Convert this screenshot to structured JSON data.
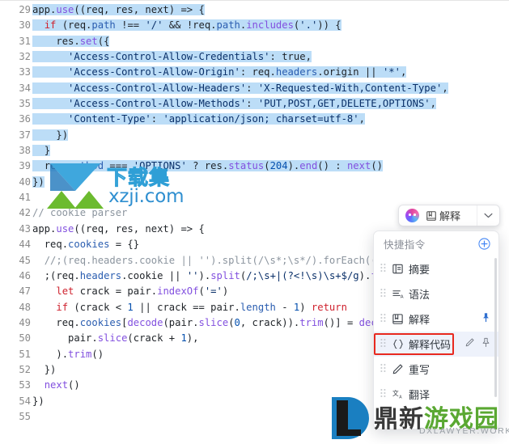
{
  "editor": {
    "language": "javascript",
    "first_line_number": 29,
    "selection_color": "#bcddf7",
    "lines": [
      {
        "n": 29,
        "sel": true,
        "indent": 0,
        "tokens": [
          {
            "t": "app",
            "c": "plain"
          },
          {
            "t": ".",
            "c": "op"
          },
          {
            "t": "use",
            "c": "fn"
          },
          {
            "t": "((req, res, next) => {",
            "c": "plain"
          }
        ]
      },
      {
        "n": 30,
        "sel": true,
        "indent": 1,
        "tokens": [
          {
            "t": "if",
            "c": "kw"
          },
          {
            "t": " (req.",
            "c": "plain"
          },
          {
            "t": "path",
            "c": "prop"
          },
          {
            "t": " !== ",
            "c": "plain"
          },
          {
            "t": "'/'",
            "c": "str"
          },
          {
            "t": " && !req.",
            "c": "plain"
          },
          {
            "t": "path",
            "c": "prop"
          },
          {
            "t": ".",
            "c": "op"
          },
          {
            "t": "includes",
            "c": "fn"
          },
          {
            "t": "(",
            "c": "plain"
          },
          {
            "t": "'.'",
            "c": "str"
          },
          {
            "t": ")) {",
            "c": "plain"
          }
        ]
      },
      {
        "n": 31,
        "sel": true,
        "indent": 2,
        "tokens": [
          {
            "t": "res",
            "c": "plain"
          },
          {
            "t": ".",
            "c": "op"
          },
          {
            "t": "set",
            "c": "fn"
          },
          {
            "t": "({",
            "c": "plain"
          }
        ]
      },
      {
        "n": 32,
        "sel": true,
        "indent": 3,
        "tokens": [
          {
            "t": "'Access-Control-Allow-Credentials'",
            "c": "str"
          },
          {
            "t": ": ",
            "c": "plain"
          },
          {
            "t": "true",
            "c": "plain"
          },
          {
            "t": ",",
            "c": "plain"
          }
        ]
      },
      {
        "n": 33,
        "sel": true,
        "indent": 3,
        "tokens": [
          {
            "t": "'Access-Control-Allow-Origin'",
            "c": "str"
          },
          {
            "t": ": req.",
            "c": "plain"
          },
          {
            "t": "headers",
            "c": "prop"
          },
          {
            "t": ".origin || ",
            "c": "plain"
          },
          {
            "t": "'*'",
            "c": "str"
          },
          {
            "t": ",",
            "c": "plain"
          }
        ]
      },
      {
        "n": 34,
        "sel": true,
        "indent": 3,
        "tokens": [
          {
            "t": "'Access-Control-Allow-Headers'",
            "c": "str"
          },
          {
            "t": ": ",
            "c": "plain"
          },
          {
            "t": "'X-Requested-With,Content-Type'",
            "c": "str"
          },
          {
            "t": ",",
            "c": "plain"
          }
        ]
      },
      {
        "n": 35,
        "sel": true,
        "indent": 3,
        "tokens": [
          {
            "t": "'Access-Control-Allow-Methods'",
            "c": "str"
          },
          {
            "t": ": ",
            "c": "plain"
          },
          {
            "t": "'PUT,POST,GET,DELETE,OPTIONS'",
            "c": "str"
          },
          {
            "t": ",",
            "c": "plain"
          }
        ]
      },
      {
        "n": 36,
        "sel": true,
        "indent": 3,
        "tokens": [
          {
            "t": "'Content-Type'",
            "c": "str"
          },
          {
            "t": ": ",
            "c": "plain"
          },
          {
            "t": "'application/json; charset=utf-8'",
            "c": "str"
          },
          {
            "t": ",",
            "c": "plain"
          }
        ]
      },
      {
        "n": 37,
        "sel": true,
        "indent": 2,
        "tokens": [
          {
            "t": "})",
            "c": "plain"
          }
        ]
      },
      {
        "n": 38,
        "sel": true,
        "indent": 1,
        "tokens": [
          {
            "t": "}",
            "c": "plain"
          }
        ]
      },
      {
        "n": 39,
        "sel": true,
        "indent": 1,
        "tokens": [
          {
            "t": "req.",
            "c": "plain"
          },
          {
            "t": "method",
            "c": "prop"
          },
          {
            "t": " === ",
            "c": "plain"
          },
          {
            "t": "'OPTIONS'",
            "c": "str"
          },
          {
            "t": " ? res.",
            "c": "plain"
          },
          {
            "t": "status",
            "c": "fn"
          },
          {
            "t": "(",
            "c": "plain"
          },
          {
            "t": "204",
            "c": "num"
          },
          {
            "t": ").",
            "c": "plain"
          },
          {
            "t": "end",
            "c": "fn"
          },
          {
            "t": "() : ",
            "c": "plain"
          },
          {
            "t": "next",
            "c": "fn"
          },
          {
            "t": "()",
            "c": "plain"
          }
        ]
      },
      {
        "n": 40,
        "sel": true,
        "indent": 0,
        "tokens": [
          {
            "t": "})",
            "c": "plain"
          }
        ]
      },
      {
        "n": 41,
        "sel": false,
        "indent": 0,
        "tokens": []
      },
      {
        "n": 42,
        "sel": false,
        "indent": 0,
        "tokens": [
          {
            "t": "// cookie parser",
            "c": "com"
          }
        ]
      },
      {
        "n": 43,
        "sel": false,
        "indent": 0,
        "tokens": [
          {
            "t": "app",
            "c": "plain"
          },
          {
            "t": ".",
            "c": "op"
          },
          {
            "t": "use",
            "c": "fn"
          },
          {
            "t": "((req, res, next) => {",
            "c": "plain"
          }
        ]
      },
      {
        "n": 44,
        "sel": false,
        "indent": 1,
        "tokens": [
          {
            "t": "req.",
            "c": "plain"
          },
          {
            "t": "cookies",
            "c": "prop"
          },
          {
            "t": " = {}",
            "c": "plain"
          }
        ]
      },
      {
        "n": 45,
        "sel": false,
        "indent": 1,
        "tokens": [
          {
            "t": "//;(req.headers.cookie || '').split(/\\s*;\\s*/).forEach((pair)",
            "c": "com"
          }
        ]
      },
      {
        "n": 46,
        "sel": false,
        "indent": 1,
        "tokens": [
          {
            "t": ";(req.",
            "c": "plain"
          },
          {
            "t": "headers",
            "c": "prop"
          },
          {
            "t": ".cookie || ",
            "c": "plain"
          },
          {
            "t": "''",
            "c": "str"
          },
          {
            "t": ").",
            "c": "plain"
          },
          {
            "t": "split",
            "c": "fn"
          },
          {
            "t": "(",
            "c": "plain"
          },
          {
            "t": "/;\\s+|(?<!\\s)\\s+$/g",
            "c": "re"
          },
          {
            "t": ").",
            "c": "plain"
          },
          {
            "t": "forEach",
            "c": "fn"
          }
        ]
      },
      {
        "n": 47,
        "sel": false,
        "indent": 2,
        "tokens": [
          {
            "t": "let",
            "c": "kw"
          },
          {
            "t": " crack = pair.",
            "c": "plain"
          },
          {
            "t": "indexOf",
            "c": "fn"
          },
          {
            "t": "(",
            "c": "plain"
          },
          {
            "t": "'='",
            "c": "str"
          },
          {
            "t": ")",
            "c": "plain"
          }
        ]
      },
      {
        "n": 48,
        "sel": false,
        "indent": 2,
        "tokens": [
          {
            "t": "if",
            "c": "kw"
          },
          {
            "t": " (crack < ",
            "c": "plain"
          },
          {
            "t": "1",
            "c": "num"
          },
          {
            "t": " || crack == pair.",
            "c": "plain"
          },
          {
            "t": "length",
            "c": "prop"
          },
          {
            "t": " - ",
            "c": "plain"
          },
          {
            "t": "1",
            "c": "num"
          },
          {
            "t": ") ",
            "c": "plain"
          },
          {
            "t": "return",
            "c": "kw"
          }
        ]
      },
      {
        "n": 49,
        "sel": false,
        "indent": 2,
        "tokens": [
          {
            "t": "req.",
            "c": "plain"
          },
          {
            "t": "cookies",
            "c": "prop"
          },
          {
            "t": "[",
            "c": "plain"
          },
          {
            "t": "decode",
            "c": "fn"
          },
          {
            "t": "(pair.",
            "c": "plain"
          },
          {
            "t": "slice",
            "c": "fn"
          },
          {
            "t": "(",
            "c": "plain"
          },
          {
            "t": "0",
            "c": "num"
          },
          {
            "t": ", crack)).",
            "c": "plain"
          },
          {
            "t": "trim",
            "c": "fn"
          },
          {
            "t": "()] = ",
            "c": "plain"
          },
          {
            "t": "decode",
            "c": "fn"
          },
          {
            "t": "(",
            "c": "plain"
          }
        ]
      },
      {
        "n": 50,
        "sel": false,
        "indent": 3,
        "tokens": [
          {
            "t": "pair.",
            "c": "plain"
          },
          {
            "t": "slice",
            "c": "fn"
          },
          {
            "t": "(crack + ",
            "c": "plain"
          },
          {
            "t": "1",
            "c": "num"
          },
          {
            "t": "),",
            "c": "plain"
          }
        ]
      },
      {
        "n": 51,
        "sel": false,
        "indent": 2,
        "tokens": [
          {
            "t": ").",
            "c": "plain"
          },
          {
            "t": "trim",
            "c": "fn"
          },
          {
            "t": "()",
            "c": "plain"
          }
        ]
      },
      {
        "n": 52,
        "sel": false,
        "indent": 1,
        "tokens": [
          {
            "t": "})",
            "c": "plain"
          }
        ]
      },
      {
        "n": 53,
        "sel": false,
        "indent": 1,
        "tokens": [
          {
            "t": "next",
            "c": "fn"
          },
          {
            "t": "()",
            "c": "plain"
          }
        ]
      },
      {
        "n": 54,
        "sel": false,
        "indent": 0,
        "tokens": [
          {
            "t": "})",
            "c": "plain"
          }
        ]
      },
      {
        "n": 55,
        "sel": false,
        "indent": 0,
        "tokens": []
      }
    ]
  },
  "ai_toolbar": {
    "orb_icon": "ai-orb-icon",
    "action_icon": "book-explain-icon",
    "action_label": "解释",
    "caret_icon": "chevron-down-icon"
  },
  "shortcut_panel": {
    "title": "快捷指令",
    "add_icon": "plus-circle-icon",
    "highlight_color": "#e8291f",
    "items": [
      {
        "icon": "summary-icon",
        "label": "摘要",
        "pinned": false,
        "active": false,
        "highlighted": false
      },
      {
        "icon": "grammar-icon",
        "label": "语法",
        "pinned": false,
        "active": false,
        "highlighted": false
      },
      {
        "icon": "book-explain-icon",
        "label": "解释",
        "pinned": true,
        "active": false,
        "highlighted": false
      },
      {
        "icon": "braces-icon",
        "label": "解释代码",
        "pinned": false,
        "active": true,
        "highlighted": true
      },
      {
        "icon": "pencil-icon",
        "label": "重写",
        "pinned": false,
        "active": false,
        "highlighted": false
      },
      {
        "icon": "translate-icon",
        "label": "翻译",
        "pinned": false,
        "active": false,
        "highlighted": false
      }
    ],
    "row_actions": {
      "edit_icon": "pencil-edit-icon",
      "pin_icon": "pin-outline-icon"
    }
  },
  "watermarks": {
    "primary": {
      "cn": "下载集",
      "en": "xzji.com"
    },
    "secondary": {
      "cn": "鼎新游戏园",
      "en": "DXLAWYER.WORK"
    }
  }
}
